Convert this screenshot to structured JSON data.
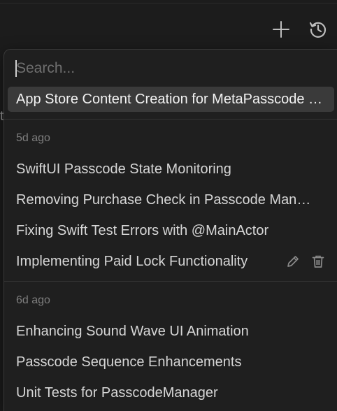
{
  "toolbar": {
    "add_icon": "plus-icon",
    "history_icon": "history-icon"
  },
  "background": {
    "peek_text": "t"
  },
  "search": {
    "value": "",
    "placeholder": "Search..."
  },
  "recent": {
    "top_item": "App Store Content Creation for MetaPasscode Setup"
  },
  "groups": [
    {
      "header": "5d ago",
      "items": [
        "SwiftUI Passcode State Monitoring",
        "Removing Purchase Check in Passcode Manager",
        "Fixing Swift Test Errors with @MainActor",
        "Implementing Paid Lock Functionality"
      ]
    },
    {
      "header": "6d ago",
      "items": [
        "Enhancing Sound Wave UI Animation",
        "Passcode Sequence Enhancements",
        "Unit Tests for PasscodeManager"
      ]
    }
  ],
  "row_actions": {
    "edit_icon": "pencil-icon",
    "delete_icon": "trash-icon"
  },
  "colors": {
    "background": "#1c1c1c",
    "popover": "#1f1f1f",
    "selected_row": "#3a3a3a",
    "text": "#d6d6d6",
    "muted": "#7e7e7e"
  }
}
